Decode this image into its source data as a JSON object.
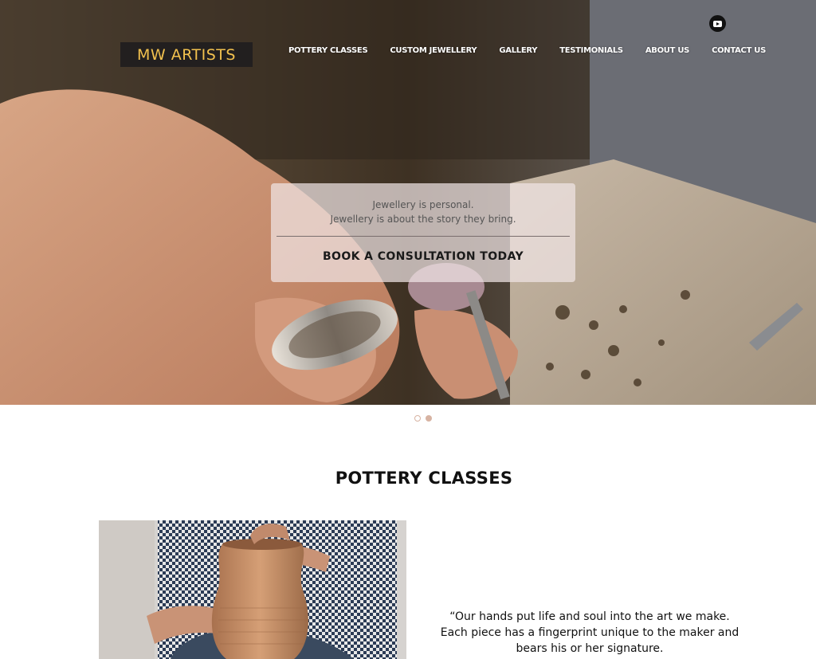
{
  "brand": {
    "logo_text": "MW ARTISTS"
  },
  "nav": {
    "items": [
      "POTTERY CLASSES",
      "CUSTOM JEWELLERY",
      "GALLERY",
      "TESTIMONIALS",
      "ABOUT US",
      "CONTACT US"
    ]
  },
  "social": {
    "icon": "youtube-icon"
  },
  "hero": {
    "caption_line1": "Jewellery is personal.",
    "caption_line2": "Jewellery is about the story they bring.",
    "cta_label": "BOOK A CONSULTATION TODAY",
    "slides_total": 2,
    "active_slide": 2
  },
  "pottery": {
    "title": "POTTERY CLASSES",
    "quote_line1": "“Our hands put life and soul into the art we make.",
    "quote_line2": "Each piece has a fingerprint unique to the maker and",
    "quote_line3": "bears his or her signature."
  },
  "colors": {
    "logo_bg": "#221f1f",
    "logo_text": "#f2c14e",
    "dot_accent": "#d7b3a2",
    "caption_bg": "#f0e4e4"
  }
}
